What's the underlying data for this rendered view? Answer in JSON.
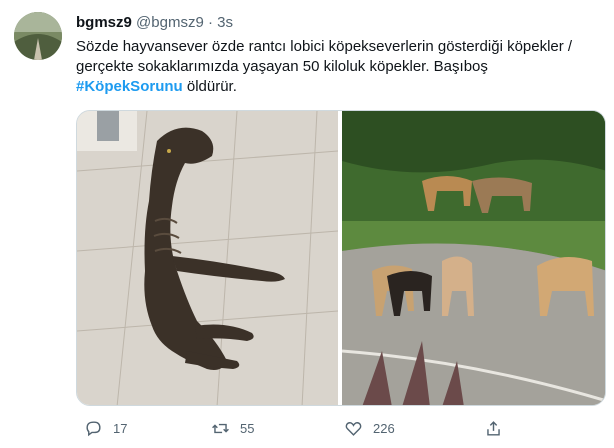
{
  "tweet": {
    "display_name": "bgmsz9",
    "handle": "@bgmsz9",
    "separator": "·",
    "time": "3s",
    "text_part1": "Sözde hayvansever özde rantcı lobici köpekseverlerin gösterdiği köpekler / gerçekte sokaklarımızda yaşayan 50 kiloluk köpekler. Başıboş",
    "hashtag": "#KöpekSorunu",
    "text_part2": "öldürür."
  },
  "actions": {
    "replies": "17",
    "retweets": "55",
    "likes": "226"
  },
  "icons": [
    "reply-icon",
    "retweet-icon",
    "like-icon",
    "share-icon"
  ],
  "colors": {
    "hashtag": "#1d9bf0",
    "text": "#0f1419",
    "muted": "#536471"
  }
}
